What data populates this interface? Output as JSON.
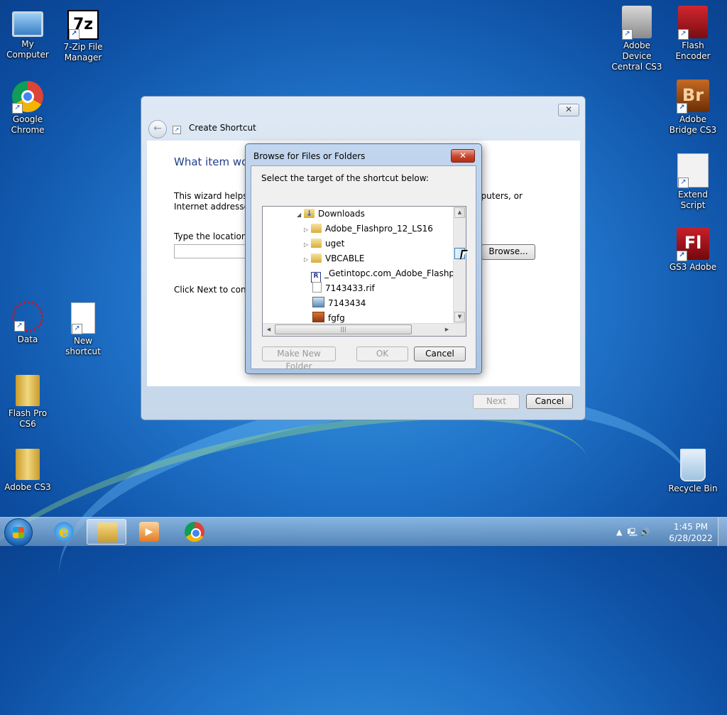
{
  "desktop": {
    "icons": [
      {
        "label": "My Computer"
      },
      {
        "label": "7-Zip File Manager",
        "glyph": "7z"
      },
      {
        "label": "Google Chrome"
      },
      {
        "label": "Adobe Device Central CS3"
      },
      {
        "label": "Flash Encoder"
      },
      {
        "label": "Adobe Bridge CS3",
        "glyph": "Br"
      },
      {
        "label": "Extend Script"
      },
      {
        "label": "GS3 Adobe",
        "glyph": "Fl"
      },
      {
        "label": "Data"
      },
      {
        "label": "New shortcut"
      },
      {
        "label": "Flash Pro CS6"
      },
      {
        "label": "Adobe CS3"
      },
      {
        "label": "Recycle Bin"
      }
    ]
  },
  "wizard": {
    "title": "Create Shortcut",
    "close_glyph": "✕",
    "back_glyph": "←",
    "heading": "What item wou",
    "description": "This wizard helps y                                                                          s, computers, or Internet addresses.",
    "desc_left": "This wizard helps y",
    "desc_right": "s, computers, or",
    "desc_line2": "Internet addresses.",
    "location_label": "Type the location o",
    "location_value": "",
    "browse_label": "Browse...",
    "next_text": "Click Next to contir",
    "next_label": "Next",
    "cancel_label": "Cancel"
  },
  "browse_dialog": {
    "title": "Browse for Files or Folders",
    "close_glyph": "✕",
    "instruction": "Select the target of the shortcut below:",
    "tree": [
      {
        "label": "Downloads",
        "expander": "◢",
        "icon": "downloads-folder"
      },
      {
        "label": "Adobe_Flashpro_12_LS16",
        "expander": "▷",
        "icon": "folder"
      },
      {
        "label": "uget",
        "expander": "▷",
        "icon": "folder"
      },
      {
        "label": "VBCABLE",
        "expander": "▷",
        "icon": "folder"
      },
      {
        "label": "_Getintopc.com_Adobe_Flashpro_",
        "expander": "",
        "icon": "rif-file",
        "glyph": "R"
      },
      {
        "label": "7143433.rif",
        "expander": "",
        "icon": "file"
      },
      {
        "label": "7143434",
        "expander": "",
        "icon": "image-file"
      },
      {
        "label": "fgfg",
        "expander": "",
        "icon": "app-file"
      }
    ],
    "scroll_up": "▲",
    "scroll_down": "▼",
    "scroll_left": "◀",
    "scroll_right": "▶",
    "hthumb_glyph": "|||",
    "make_folder_label": "Make New Folder",
    "ok_label": "OK",
    "cancel_label": "Cancel"
  },
  "taskbar": {
    "ie_glyph": "e",
    "media_glyph": "▶",
    "tray_up": "▲",
    "tray_icons": "🖳 🔊",
    "time": "1:45 PM",
    "date": "6/28/2022"
  }
}
